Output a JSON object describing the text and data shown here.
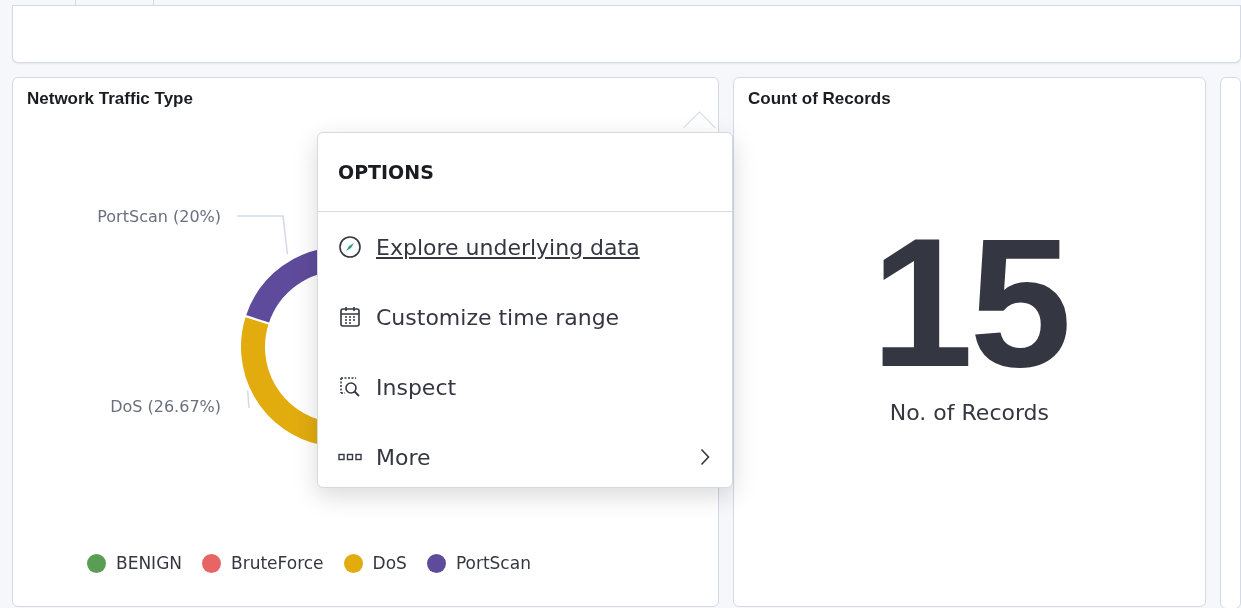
{
  "traffic_panel": {
    "title": "Network Traffic Type",
    "chart_data": {
      "type": "donut",
      "categories": [
        "BENIGN",
        "BruteForce",
        "DoS",
        "PortScan"
      ],
      "values": [
        null,
        null,
        26.67,
        20
      ],
      "colors": [
        "#5a9e56",
        "#e86565",
        "#e2ac0f",
        "#5f4b9b"
      ],
      "value_labels": [
        null,
        null,
        "DoS (26.67%)",
        "PortScan (20%)"
      ]
    }
  },
  "records_panel": {
    "title": "Count of Records",
    "value": "15",
    "caption": "No. of Records"
  },
  "options_menu": {
    "title": "OPTIONS",
    "items": [
      {
        "kind": "explore",
        "label": "Explore underlying data",
        "highlighted": true,
        "submenu": false
      },
      {
        "kind": "calendar",
        "label": "Customize time range",
        "highlighted": false,
        "submenu": false
      },
      {
        "kind": "inspect",
        "label": "Inspect",
        "highlighted": false,
        "submenu": false
      },
      {
        "kind": "more",
        "label": "More",
        "highlighted": false,
        "submenu": true
      }
    ]
  }
}
